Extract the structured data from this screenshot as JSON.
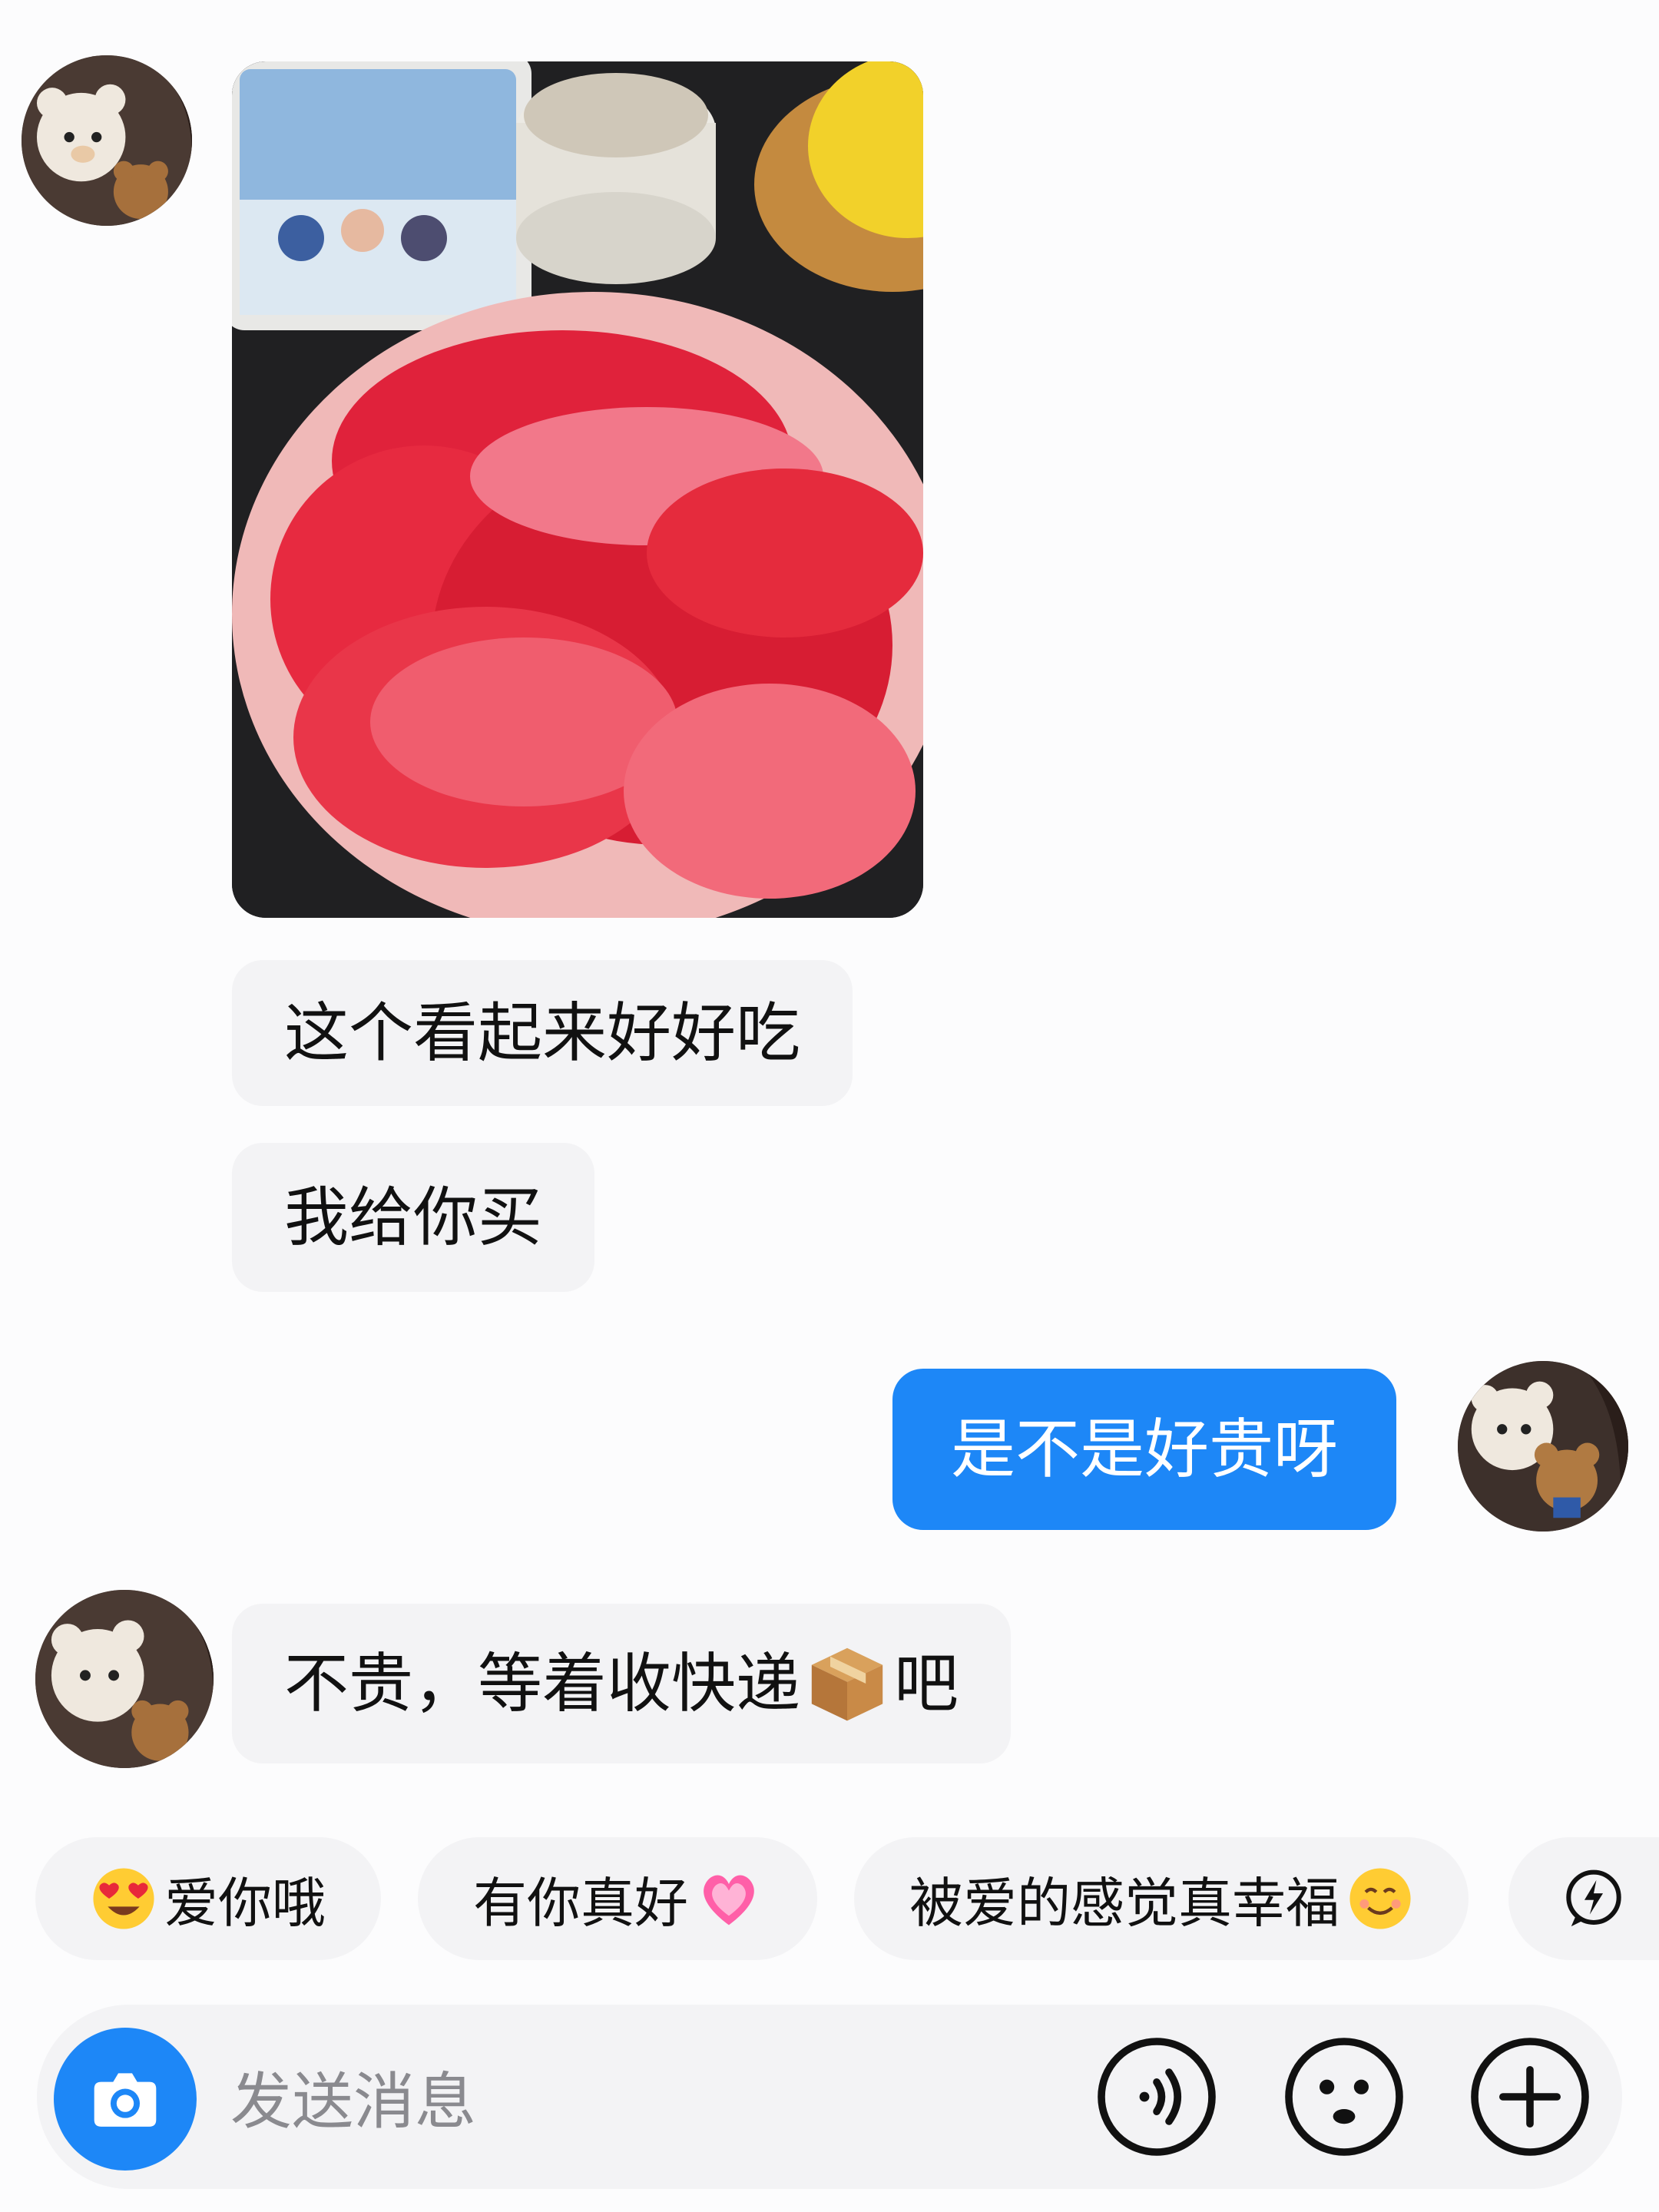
{
  "messages": [
    {
      "side": "incoming",
      "type": "image",
      "alt": "grapefruit-photo"
    },
    {
      "side": "incoming",
      "type": "text",
      "text": "这个看起来好好吃"
    },
    {
      "side": "incoming",
      "type": "text",
      "text": "我给你买"
    },
    {
      "side": "outgoing",
      "type": "text",
      "text": "是不是好贵呀"
    },
    {
      "side": "incoming",
      "type": "text",
      "text_before": "不贵，等着收快递",
      "emoji": "package-emoji",
      "text_after": "吧"
    }
  ],
  "quick_replies": [
    {
      "emoji": "heart-eyes-emoji",
      "label": "爱你哦"
    },
    {
      "label": "有你真好",
      "emoji": "sparkling-heart-emoji"
    },
    {
      "label": "被爱的感觉真幸福",
      "emoji": "smiling-face-emoji"
    },
    {
      "icon": "lightning-chat-icon",
      "label": ""
    }
  ],
  "composer": {
    "placeholder": "发送消息",
    "camera_icon": "camera-icon",
    "voice_icon": "voice-icon",
    "emoji_icon": "emoji-icon",
    "plus_icon": "plus-icon"
  },
  "colors": {
    "accent": "#1d87f7",
    "bubble_incoming": "#f3f3f5",
    "background": "#fcfcfd"
  }
}
